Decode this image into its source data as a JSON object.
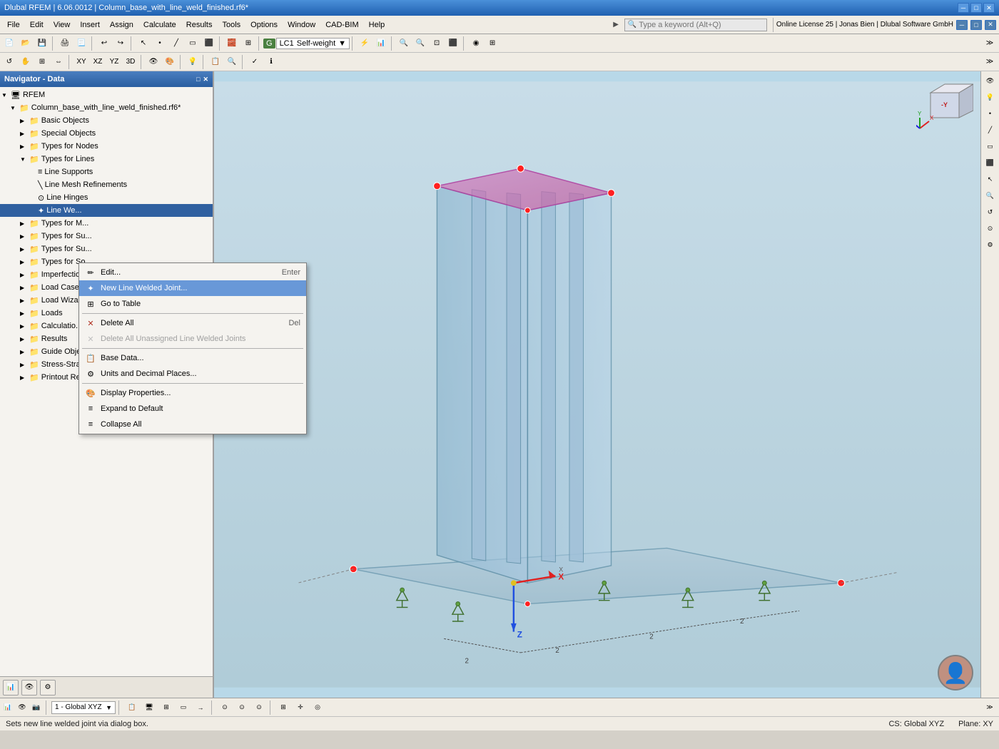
{
  "titleBar": {
    "text": "Dlubal RFEM | 6.06.0012 | Column_base_with_line_weld_finished.rf6*",
    "minimize": "─",
    "maximize": "□",
    "close": "✕"
  },
  "menuBar": {
    "items": [
      "File",
      "Edit",
      "View",
      "Insert",
      "Assign",
      "Calculate",
      "Results",
      "Tools",
      "Options",
      "Window",
      "CAD-BIM",
      "Help"
    ]
  },
  "searchBar": {
    "placeholder": "Type a keyword (Alt+Q)"
  },
  "lcArea": {
    "box": "G",
    "lc": "LC1",
    "label": "Self-weight"
  },
  "topInfo": {
    "text": "Online License 25 | Jonas Bien | Dlubal Software GmbH"
  },
  "navigator": {
    "title": "Navigator - Data",
    "tree": [
      {
        "id": "rfem",
        "label": "RFEM",
        "indent": 0,
        "arrow": "▼",
        "icon": "🖥"
      },
      {
        "id": "column-base",
        "label": "Column_base_with_line_weld_finished.rf6*",
        "indent": 1,
        "arrow": "▼",
        "icon": "📁"
      },
      {
        "id": "basic-objects",
        "label": "Basic Objects",
        "indent": 2,
        "arrow": "▶",
        "icon": "📁"
      },
      {
        "id": "special-objects",
        "label": "Special Objects",
        "indent": 2,
        "arrow": "▶",
        "icon": "📁"
      },
      {
        "id": "types-nodes",
        "label": "Types for Nodes",
        "indent": 2,
        "arrow": "▶",
        "icon": "📁"
      },
      {
        "id": "types-lines",
        "label": "Types for Lines",
        "indent": 2,
        "arrow": "▼",
        "icon": "📁"
      },
      {
        "id": "line-supports",
        "label": "Line Supports",
        "indent": 3,
        "arrow": "",
        "icon": "≡"
      },
      {
        "id": "line-mesh-refinements",
        "label": "Line Mesh Refinements",
        "indent": 3,
        "arrow": "",
        "icon": "\\"
      },
      {
        "id": "line-hinges",
        "label": "Line Hinges",
        "indent": 3,
        "arrow": "",
        "icon": ""
      },
      {
        "id": "line-welded",
        "label": "Line We...",
        "indent": 3,
        "arrow": "",
        "icon": "✦",
        "selected": true
      },
      {
        "id": "types-m",
        "label": "Types for M...",
        "indent": 2,
        "arrow": "▶",
        "icon": "📁"
      },
      {
        "id": "types-su",
        "label": "Types for Su...",
        "indent": 2,
        "arrow": "▶",
        "icon": "📁"
      },
      {
        "id": "types-su2",
        "label": "Types for Su...",
        "indent": 2,
        "arrow": "▶",
        "icon": "📁"
      },
      {
        "id": "types-so",
        "label": "Types for So...",
        "indent": 2,
        "arrow": "▶",
        "icon": "📁"
      },
      {
        "id": "imperfections",
        "label": "Imperfectio...",
        "indent": 2,
        "arrow": "▶",
        "icon": "📁"
      },
      {
        "id": "load-cases",
        "label": "Load Cases",
        "indent": 2,
        "arrow": "▶",
        "icon": "📁"
      },
      {
        "id": "load-wizard",
        "label": "Load Wizar...",
        "indent": 2,
        "arrow": "▶",
        "icon": "📁"
      },
      {
        "id": "loads",
        "label": "Loads",
        "indent": 2,
        "arrow": "▶",
        "icon": "📁"
      },
      {
        "id": "calculation",
        "label": "Calculatio...",
        "indent": 2,
        "arrow": "▶",
        "icon": "📁"
      },
      {
        "id": "results",
        "label": "Results",
        "indent": 2,
        "arrow": "▶",
        "icon": "📁"
      },
      {
        "id": "guide-obj",
        "label": "Guide Obje...",
        "indent": 2,
        "arrow": "▶",
        "icon": "📁"
      },
      {
        "id": "stress-strain",
        "label": "Stress-Strai...",
        "indent": 2,
        "arrow": "▶",
        "icon": "📁"
      },
      {
        "id": "printout",
        "label": "Printout Re...",
        "indent": 2,
        "arrow": "▶",
        "icon": "📁"
      }
    ]
  },
  "contextMenu": {
    "items": [
      {
        "id": "edit",
        "label": "Edit...",
        "shortcut": "Enter",
        "icon": "✏",
        "disabled": false,
        "active": false
      },
      {
        "id": "new-line-welded",
        "label": "New Line Welded Joint...",
        "shortcut": "",
        "icon": "✦",
        "disabled": false,
        "active": true
      },
      {
        "id": "go-to-table",
        "label": "Go to Table",
        "shortcut": "",
        "icon": "⊞",
        "disabled": false,
        "active": false
      },
      {
        "id": "sep1",
        "separator": true
      },
      {
        "id": "delete-all",
        "label": "Delete All",
        "shortcut": "Del",
        "icon": "🗑",
        "disabled": false,
        "active": false
      },
      {
        "id": "delete-unassigned",
        "label": "Delete All Unassigned Line Welded Joints",
        "shortcut": "",
        "icon": "🗑",
        "disabled": true,
        "active": false
      },
      {
        "id": "sep2",
        "separator": true
      },
      {
        "id": "base-data",
        "label": "Base Data...",
        "shortcut": "",
        "icon": "📋",
        "disabled": false,
        "active": false
      },
      {
        "id": "units",
        "label": "Units and Decimal Places...",
        "shortcut": "",
        "icon": "⚙",
        "disabled": false,
        "active": false
      },
      {
        "id": "sep3",
        "separator": true
      },
      {
        "id": "display-properties",
        "label": "Display Properties...",
        "shortcut": "",
        "icon": "🎨",
        "disabled": false,
        "active": false
      },
      {
        "id": "expand-default",
        "label": "Expand to Default",
        "shortcut": "",
        "icon": "≡",
        "disabled": false,
        "active": false
      },
      {
        "id": "collapse-all",
        "label": "Collapse All",
        "shortcut": "",
        "icon": "≡",
        "disabled": false,
        "active": false
      }
    ]
  },
  "statusBar": {
    "tooltip": "Sets new line welded joint via dialog box.",
    "cs": "CS: Global XYZ",
    "plane": "Plane: XY"
  },
  "bottomLeft": {
    "globalXYZ": "1 - Global XYZ"
  }
}
